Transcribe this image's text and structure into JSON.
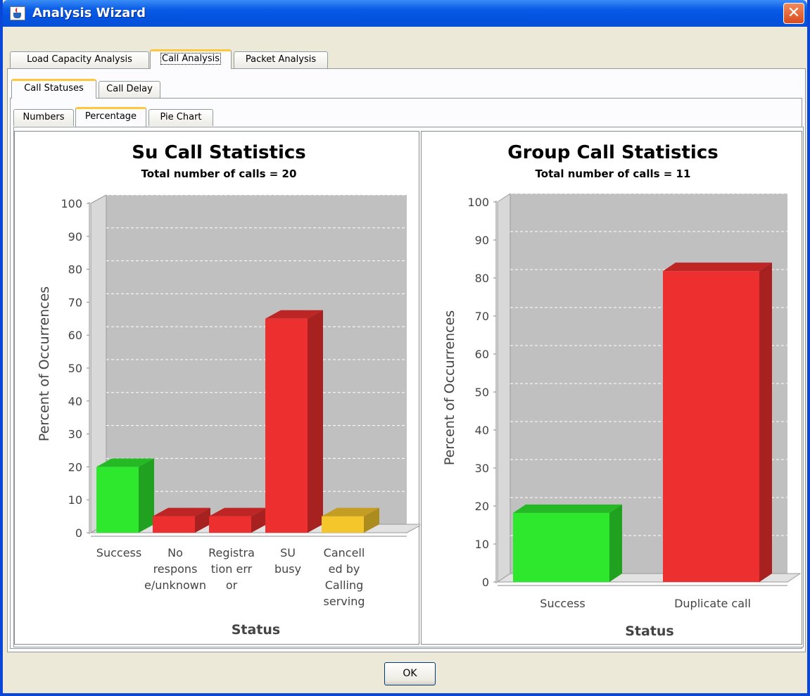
{
  "window": {
    "title": "Analysis Wizard"
  },
  "main_tabs": [
    {
      "label": "Load Capacity Analysis"
    },
    {
      "label": "Call Analysis"
    },
    {
      "label": "Packet Analysis"
    }
  ],
  "sub_tabs": [
    {
      "label": "Call Statuses"
    },
    {
      "label": "Call Delay"
    }
  ],
  "view_tabs": [
    {
      "label": "Numbers"
    },
    {
      "label": "Percentage"
    },
    {
      "label": "Pie Chart"
    }
  ],
  "buttons": {
    "ok": "OK"
  },
  "colors": {
    "success": "#2ee82e",
    "error": "#ee2f2f",
    "cancelled": "#f5c62c",
    "plot_bg": "#c0c0c0"
  },
  "chart_data": [
    {
      "type": "bar",
      "title": "Su Call Statistics",
      "subtitle": "Total number of calls = 20",
      "xlabel": "Status",
      "ylabel": "Percent of Occurrences",
      "ylim": [
        0,
        100
      ],
      "yticks": [
        "0",
        "10",
        "20",
        "30",
        "40",
        "50",
        "60",
        "70",
        "80",
        "90",
        "100"
      ],
      "categories": [
        "Success",
        "No response/unknown",
        "Registration error",
        "SU busy",
        "Cancelled by Calling serving"
      ],
      "category_label_lines": [
        [
          "Success"
        ],
        [
          "No",
          "respons",
          "e/unknown"
        ],
        [
          "Registra",
          "tion err",
          "or"
        ],
        [
          "SU",
          "busy"
        ],
        [
          "Cancell",
          "ed by",
          "Calling",
          "serving"
        ]
      ],
      "values": [
        20,
        5,
        5,
        65,
        5
      ],
      "colors": [
        "#2ee82e",
        "#ee2f2f",
        "#ee2f2f",
        "#ee2f2f",
        "#f5c62c"
      ],
      "grid": true
    },
    {
      "type": "bar",
      "title": "Group Call Statistics",
      "subtitle": "Total number of calls = 11",
      "xlabel": "Status",
      "ylabel": "Percent of Occurrences",
      "ylim": [
        0,
        100
      ],
      "yticks": [
        "0",
        "10",
        "20",
        "30",
        "40",
        "50",
        "60",
        "70",
        "80",
        "90",
        "100"
      ],
      "categories": [
        "Success",
        "Duplicate call"
      ],
      "category_label_lines": [
        [
          "Success"
        ],
        [
          "Duplicate call"
        ]
      ],
      "values": [
        18.18,
        81.82
      ],
      "colors": [
        "#2ee82e",
        "#ee2f2f"
      ],
      "grid": true
    }
  ]
}
